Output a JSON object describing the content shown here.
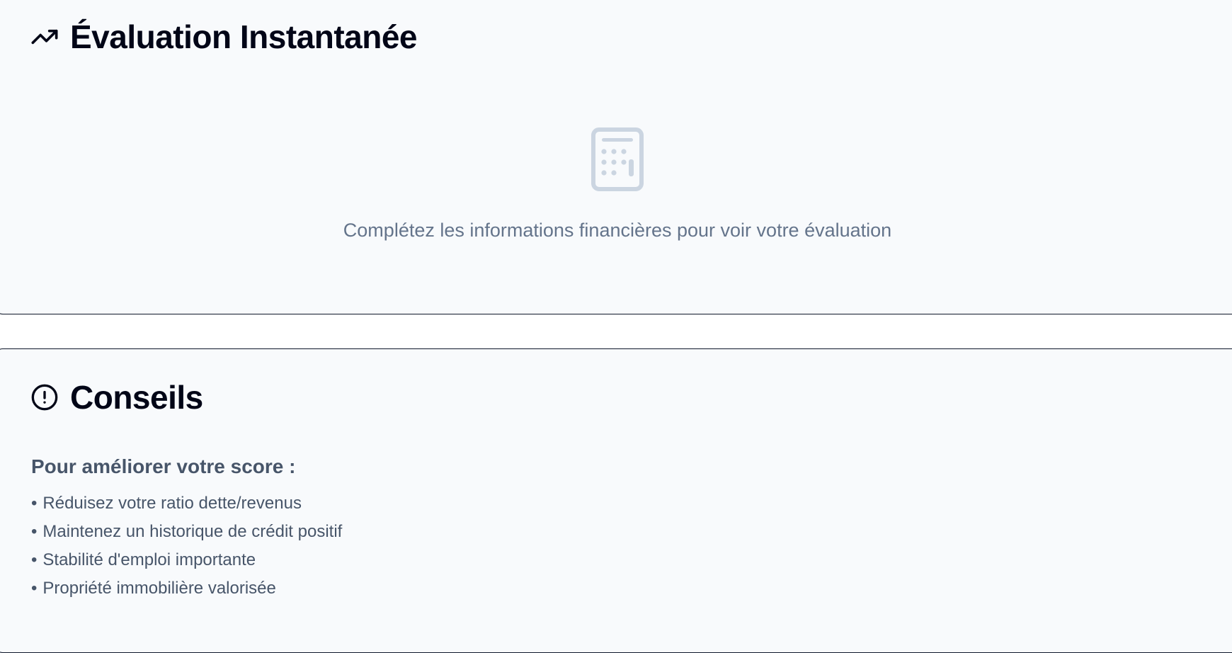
{
  "evaluation": {
    "title": "Évaluation Instantanée",
    "icon": "trending-up-icon",
    "empty_icon": "calculator-icon",
    "empty_message": "Complétez les informations financières pour voir votre évaluation"
  },
  "tips": {
    "title": "Conseils",
    "icon": "alert-circle-icon",
    "subtitle": "Pour améliorer votre score :",
    "bullet": "•",
    "items": [
      "Réduisez votre ratio dette/revenus",
      "Maintenez un historique de crédit positif",
      "Stabilité d'emploi importante",
      "Propriété immobilière valorisée"
    ]
  },
  "colors": {
    "card_background": "#f8fafc",
    "card_border": "#0f172a",
    "title_text": "#020617",
    "muted_text": "#64748b",
    "body_text": "#475569",
    "empty_icon": "#cbd5e1"
  }
}
